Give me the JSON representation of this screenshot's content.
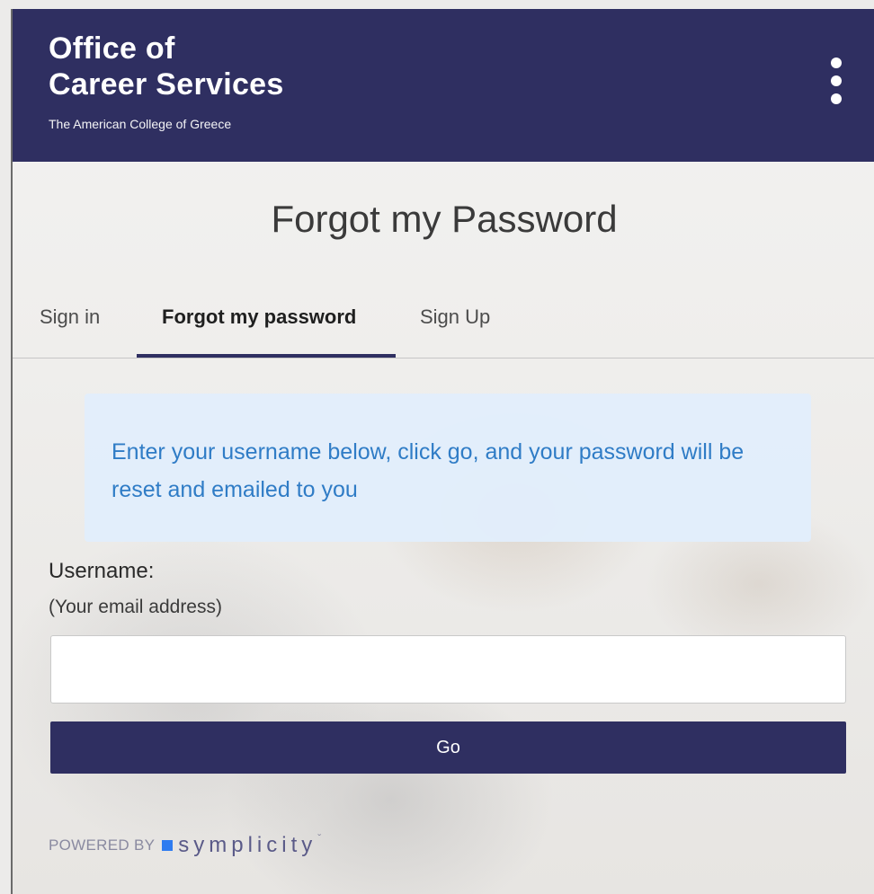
{
  "header": {
    "brand_line1": "Office of",
    "brand_line2": "Career Services",
    "brand_sub": "The American College of Greece",
    "menu_icon": "vertical-ellipsis-icon"
  },
  "page": {
    "title": "Forgot my Password"
  },
  "tabs": [
    {
      "label": "Sign in",
      "active": false
    },
    {
      "label": "Forgot my password",
      "active": true
    },
    {
      "label": "Sign Up",
      "active": false
    }
  ],
  "info": {
    "message": "Enter your username below, click go, and your password will be reset and emailed to you"
  },
  "form": {
    "username_label": "Username:",
    "username_hint": "(Your email address)",
    "username_value": "",
    "username_placeholder": "",
    "submit_label": "Go"
  },
  "footer": {
    "powered_by": "POWERED BY",
    "brand": "symplicity",
    "brand_mark": "ˇ"
  },
  "colors": {
    "primary": "#2f2f61",
    "info_text": "#2f7cc6",
    "info_bg": "#e1eefc"
  }
}
